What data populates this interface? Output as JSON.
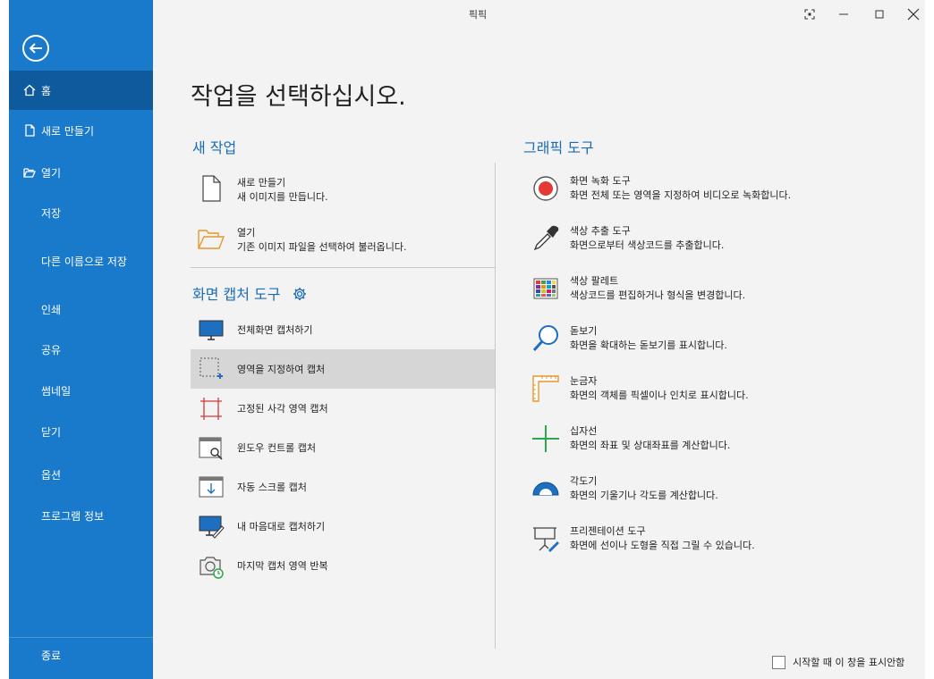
{
  "window": {
    "title": "픽픽"
  },
  "sidebar": {
    "items": [
      {
        "label": "홈",
        "icon": "home-icon"
      },
      {
        "label": "새로 만들기",
        "icon": "new-file-icon"
      },
      {
        "label": "열기",
        "icon": "folder-open-icon"
      },
      {
        "label": "저장"
      },
      {
        "label": "다른 이름으로 저장"
      },
      {
        "label": "인쇄"
      },
      {
        "label": "공유"
      },
      {
        "label": "썸네일"
      },
      {
        "label": "닫기"
      },
      {
        "label": "옵션"
      },
      {
        "label": "프로그램 정보"
      }
    ],
    "exit_label": "종료"
  },
  "main": {
    "heading": "작업을 선택하십시오.",
    "new_task": {
      "title": "새 작업",
      "items": [
        {
          "title": "새로 만들기",
          "desc": "새 이미지를 만듭니다."
        },
        {
          "title": "열기",
          "desc": "기존 이미지 파일을 선택하여 불러옵니다."
        }
      ]
    },
    "capture": {
      "title": "화면 캡처 도구",
      "items": [
        {
          "label": "전체화면 캡처하기"
        },
        {
          "label": "영역을 지정하여 캡처"
        },
        {
          "label": "고정된 사각 영역 캡처"
        },
        {
          "label": "윈도우 컨트롤 캡처"
        },
        {
          "label": "자동 스크롤 캡처"
        },
        {
          "label": "내 마음대로 캡처하기"
        },
        {
          "label": "마지막 캡처 영역 반복"
        }
      ]
    },
    "graphic": {
      "title": "그래픽 도구",
      "items": [
        {
          "title": "화면 녹화 도구",
          "desc": "화면 전체 또는 영역을 지정하여 비디오로 녹화합니다."
        },
        {
          "title": "색상 추출 도구",
          "desc": "화면으로부터 색상코드를 추출합니다."
        },
        {
          "title": "색상 팔레트",
          "desc": "색상코드를 편집하거나 형식을 변경합니다."
        },
        {
          "title": "돋보기",
          "desc": "화면을 확대하는 돋보기를 표시합니다."
        },
        {
          "title": "눈금자",
          "desc": "화면의 객체를 픽셀이나 인치로 표시합니다."
        },
        {
          "title": "십자선",
          "desc": "화면의 좌표 및 상대좌표를 계산합니다."
        },
        {
          "title": "각도기",
          "desc": "화면의 기울기나 각도를 계산합니다."
        },
        {
          "title": "프리젠테이션 도구",
          "desc": "화면에 선이나 도형을 직접 그릴 수 있습니다."
        }
      ]
    }
  },
  "footer": {
    "dont_show_label": "시작할 때 이 창을 표시안함",
    "dont_show_checked": false
  },
  "colors": {
    "sidebar": "#1979ca",
    "sidebar_active": "#0e5a9c",
    "accent": "#1a6bb5",
    "highlight": "#d6d6d6"
  }
}
